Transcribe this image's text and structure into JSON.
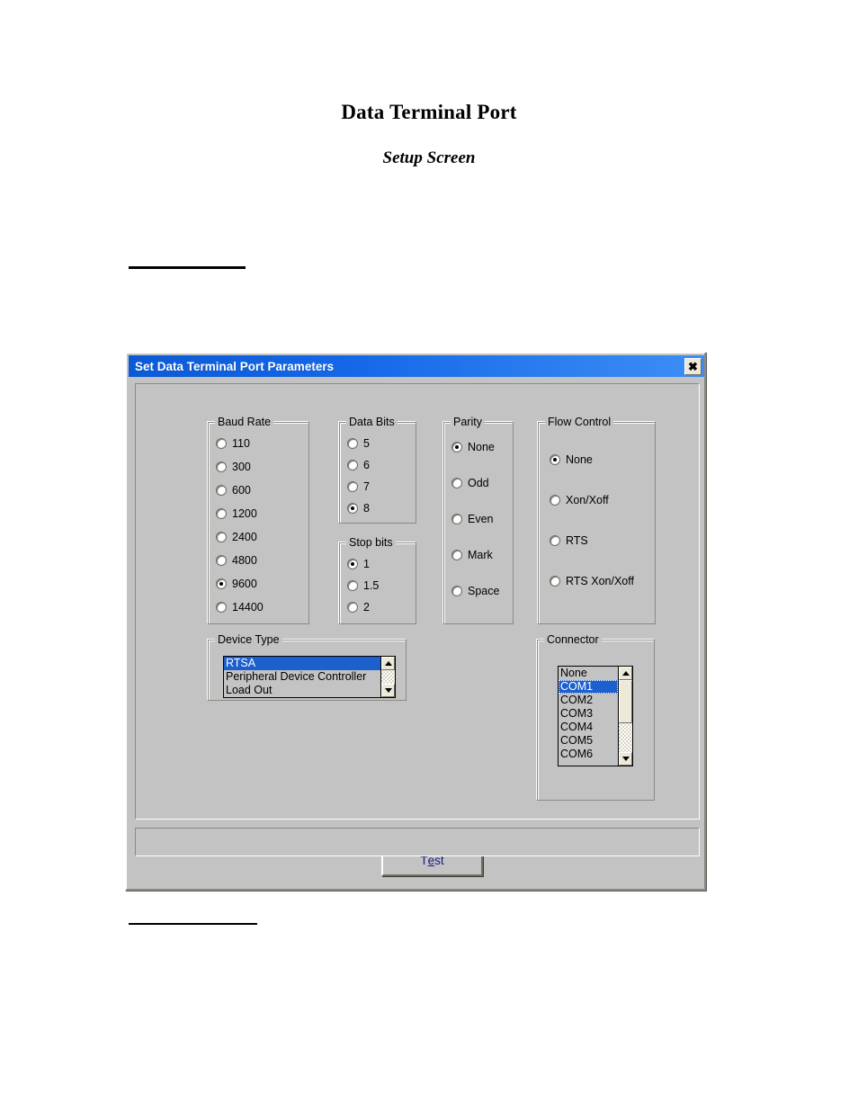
{
  "document": {
    "title": "Data Terminal Port",
    "subtitle": "Setup Screen"
  },
  "dialog": {
    "titlebar": {
      "text": "Set Data Terminal Port Parameters",
      "close_glyph": "✖",
      "gradient_start": "#0a5ad8",
      "gradient_end": "#3d8ef5"
    },
    "groups": {
      "baud_rate": {
        "label": "Baud Rate",
        "options": [
          "110",
          "300",
          "600",
          "1200",
          "2400",
          "4800",
          "9600",
          "14400"
        ],
        "selected": "9600"
      },
      "data_bits": {
        "label": "Data Bits",
        "options": [
          "5",
          "6",
          "7",
          "8"
        ],
        "selected": "8"
      },
      "stop_bits": {
        "label": "Stop bits",
        "options": [
          "1",
          "1.5",
          "2"
        ],
        "selected": "1"
      },
      "parity": {
        "label": "Parity",
        "options": [
          "None",
          "Odd",
          "Even",
          "Mark",
          "Space"
        ],
        "selected": "None"
      },
      "flow_control": {
        "label": "Flow Control",
        "options": [
          "None",
          "Xon/Xoff",
          "RTS",
          "RTS Xon/Xoff"
        ],
        "selected": "None"
      },
      "device_type": {
        "label": "Device Type",
        "options": [
          "RTSA",
          "Peripheral Device Controller",
          "Load Out"
        ],
        "selected": "RTSA"
      },
      "connector": {
        "label": "Connector",
        "options": [
          "None",
          "COM1",
          "COM2",
          "COM3",
          "COM4",
          "COM5",
          "COM6"
        ],
        "selected": "COM1"
      }
    },
    "buttons": {
      "test": {
        "label_before": "T",
        "label_accel": "e",
        "label_after": "st",
        "text_color": "#1a1a7a"
      }
    },
    "statusbar": {
      "text": ""
    }
  },
  "colors": {
    "face": "#c3c3c3",
    "selection": "#1c5fcd",
    "scroll_face": "#ece9d8"
  }
}
